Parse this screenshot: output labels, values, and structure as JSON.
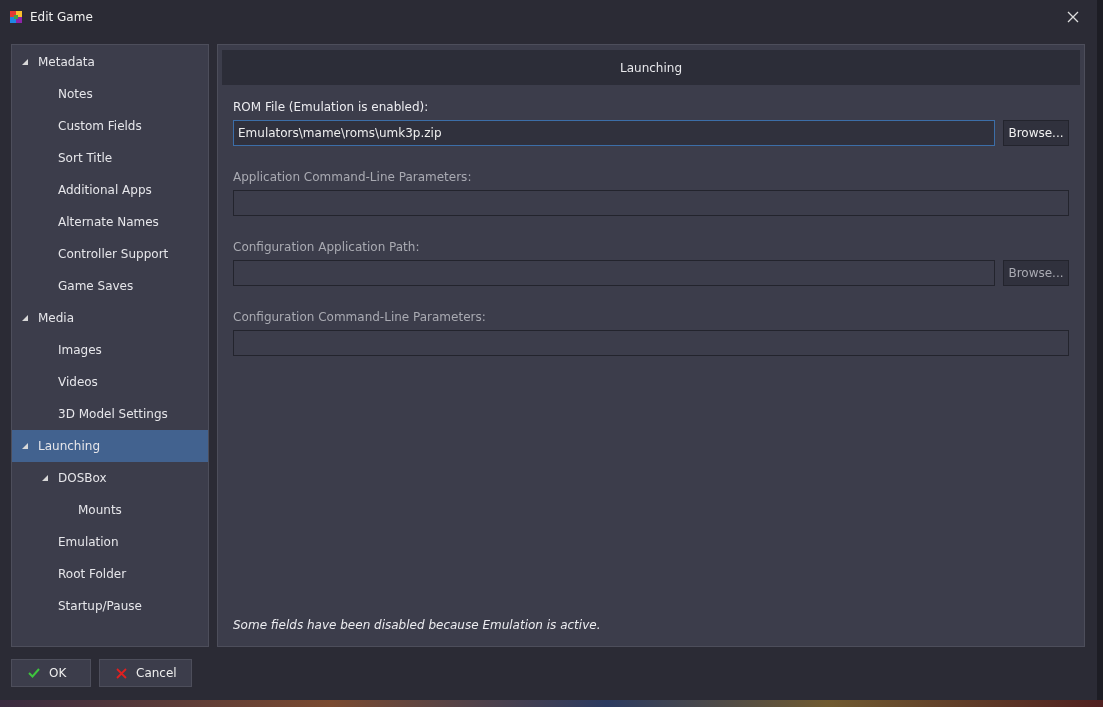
{
  "window": {
    "title": "Edit Game"
  },
  "nav": [
    {
      "label": "Metadata",
      "expanded": true,
      "selected": false,
      "children": [
        {
          "label": "Notes",
          "selected": false
        },
        {
          "label": "Custom Fields",
          "selected": false
        },
        {
          "label": "Sort Title",
          "selected": false
        },
        {
          "label": "Additional Apps",
          "selected": false
        },
        {
          "label": "Alternate Names",
          "selected": false
        },
        {
          "label": "Controller Support",
          "selected": false
        },
        {
          "label": "Game Saves",
          "selected": false
        }
      ]
    },
    {
      "label": "Media",
      "expanded": true,
      "selected": false,
      "children": [
        {
          "label": "Images",
          "selected": false
        },
        {
          "label": "Videos",
          "selected": false
        },
        {
          "label": "3D Model Settings",
          "selected": false
        }
      ]
    },
    {
      "label": "Launching",
      "expanded": true,
      "selected": true,
      "children": [
        {
          "label": "DOSBox",
          "expanded": true,
          "selected": false,
          "children": [
            {
              "label": "Mounts",
              "selected": false
            }
          ]
        },
        {
          "label": "Emulation",
          "selected": false
        },
        {
          "label": "Root Folder",
          "selected": false
        },
        {
          "label": "Startup/Pause",
          "selected": false
        }
      ]
    }
  ],
  "panel": {
    "title": "Launching",
    "fields": [
      {
        "label": "ROM File (Emulation is enabled):",
        "value": "Emulators\\mame\\roms\\umk3p.zip",
        "disabled": false,
        "focused": true,
        "browse": {
          "label": "Browse...",
          "disabled": false
        }
      },
      {
        "label": "Application Command-Line Parameters:",
        "disabled": true,
        "focused": false
      },
      {
        "label": "Configuration Application Path:",
        "disabled": true,
        "focused": false,
        "browse": {
          "label": "Browse...",
          "disabled": true
        }
      },
      {
        "label": "Configuration Command-Line Parameters:",
        "disabled": true,
        "focused": false
      }
    ],
    "note": "Some fields have been disabled because Emulation is active."
  },
  "buttons": [
    {
      "label": "OK",
      "kind": "ok"
    },
    {
      "label": "Cancel",
      "kind": "cancel"
    }
  ]
}
